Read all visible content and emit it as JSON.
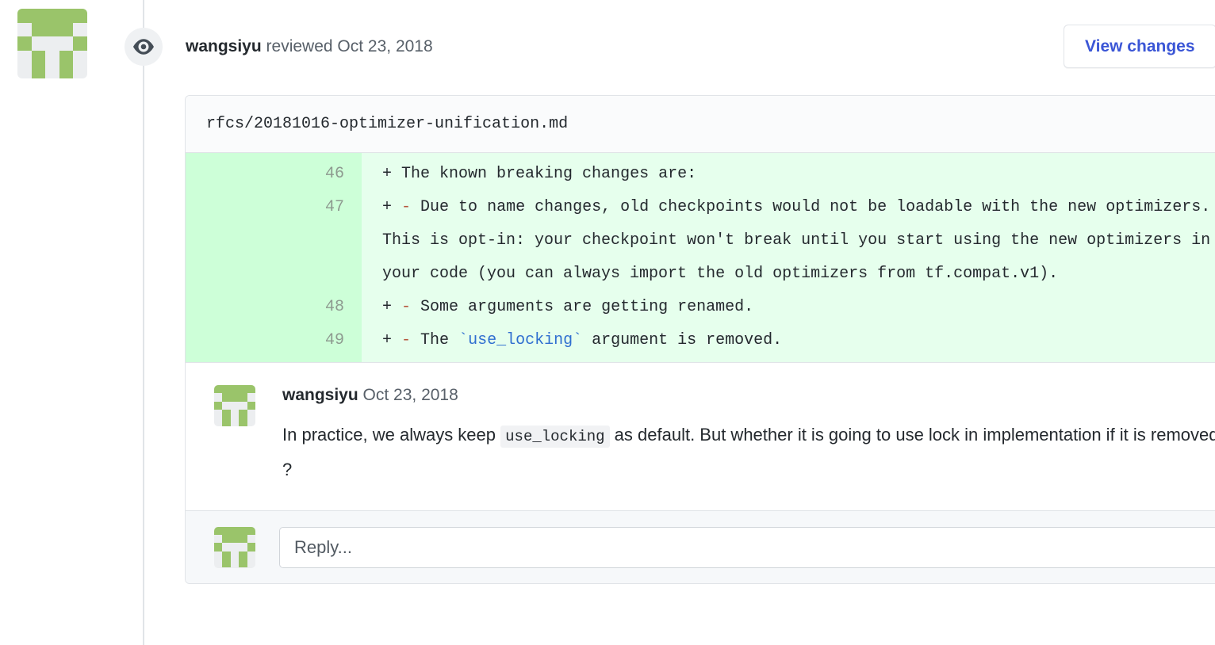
{
  "review": {
    "author": "wangsiyu",
    "action": " reviewed ",
    "date": "Oct 23, 2018",
    "eye_icon": "eye-icon",
    "view_changes_label": "View changes"
  },
  "avatar": {
    "icon": "identicon-avatar",
    "color": "#9ac46a",
    "background": "#eceef0",
    "pattern": [
      [
        1,
        1,
        1,
        1,
        1
      ],
      [
        0,
        1,
        1,
        1,
        0
      ],
      [
        1,
        0,
        0,
        0,
        1
      ],
      [
        0,
        1,
        0,
        1,
        0
      ],
      [
        0,
        1,
        0,
        1,
        0
      ]
    ]
  },
  "diff": {
    "file_name": "rfcs/20181016-optimizer-unification.md",
    "added_bg": "#e6ffed",
    "gutter_bg": "#cdffd8",
    "lines": [
      {
        "number": "46",
        "marker": "+",
        "bullet": "",
        "text": " The known breaking changes are:"
      },
      {
        "number": "47",
        "marker": "+",
        "bullet": "-",
        "text": " Due to name changes, old checkpoints would not be loadable with the new optimizers. This is opt-in: your checkpoint won't break until you start using the new optimizers in your code (you can always import the old optimizers from tf.compat.v1)."
      },
      {
        "number": "48",
        "marker": "+",
        "bullet": "-",
        "text": " Some arguments are getting renamed."
      },
      {
        "number": "49",
        "marker": "+",
        "bullet": "-",
        "text_before": " The ",
        "code": "`use_locking`",
        "text_after": " argument is removed."
      }
    ]
  },
  "comment": {
    "author": "wangsiyu",
    "date": "Oct 23, 2018",
    "body_before": "In practice, we always keep ",
    "body_code": "use_locking",
    "body_after": " as default. But whether it is going to use lock in implementation if it is removed ?"
  },
  "reply": {
    "placeholder": "Reply...",
    "value": ""
  }
}
